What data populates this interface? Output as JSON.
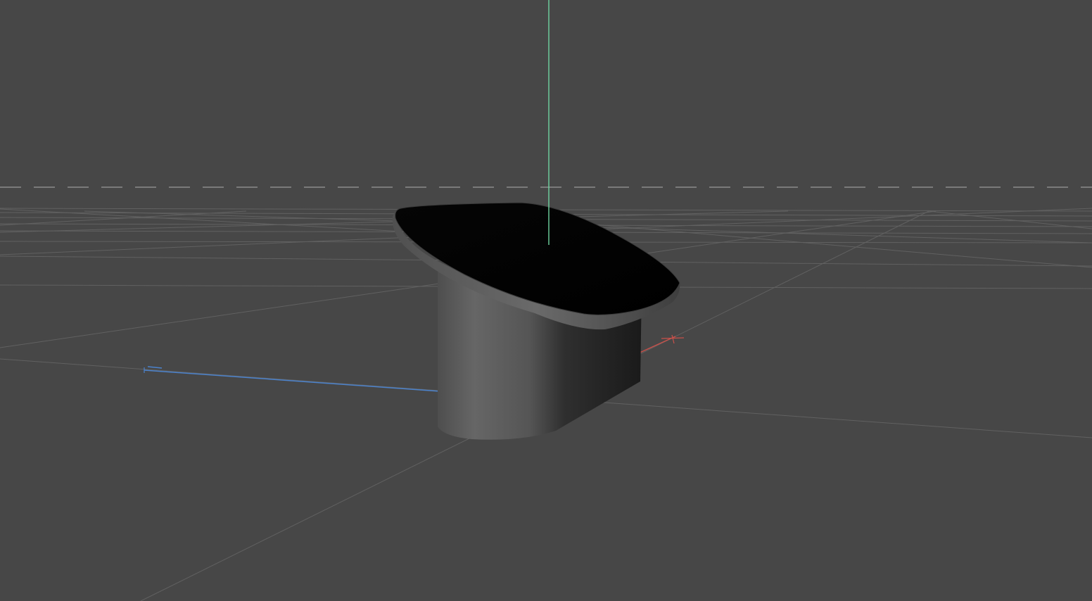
{
  "viewport": {
    "background": "#474747",
    "grid_color": "#5f5f5f",
    "horizon_color": "#8a8a8a",
    "axes": {
      "x_axis_color": "#c8504a",
      "y_axis_color": "#6fd4a0",
      "z_axis_color": "#4b82cc"
    },
    "object": {
      "icon": "stool-3d-model",
      "top_color": "#000000",
      "rim_color": "#5a5a5a",
      "body_light": "#666666",
      "body_dark": "#1c1c1c"
    }
  }
}
